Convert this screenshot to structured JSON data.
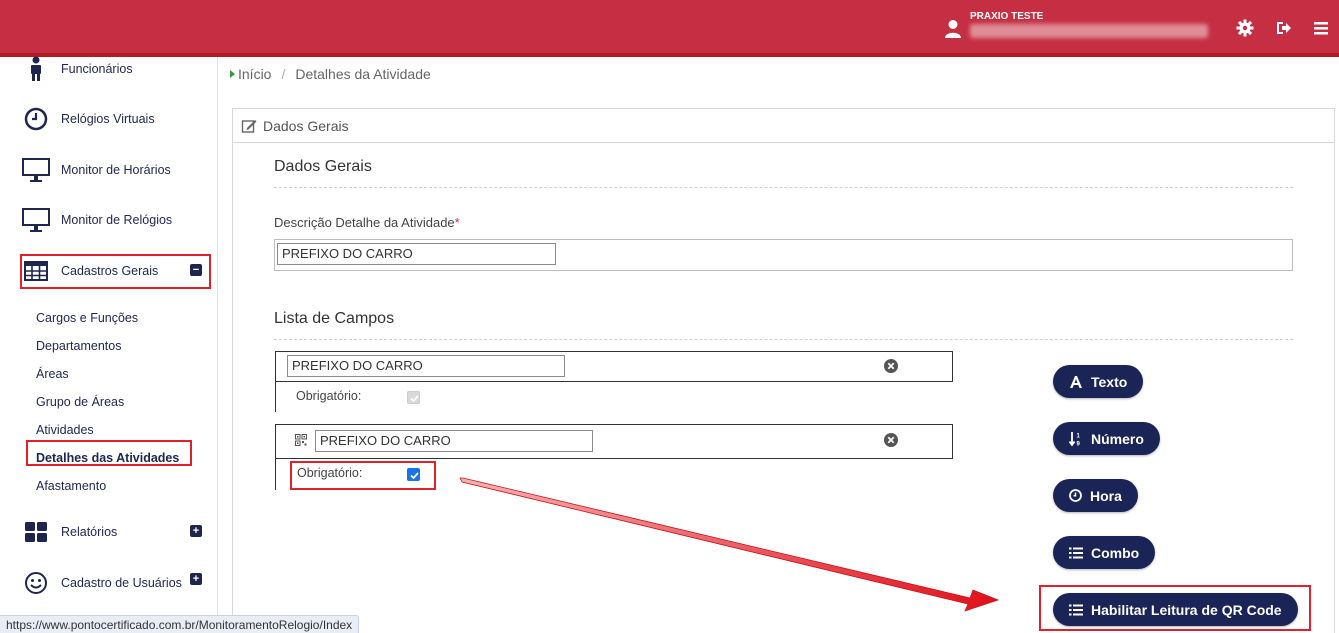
{
  "header": {
    "user_name": "PRAXIO TESTE",
    "user_email": "•••••••••••••••••",
    "icons": [
      "user-icon",
      "gear-icon",
      "logout-icon",
      "menu-icon"
    ],
    "bar_color": "#c62f43"
  },
  "sidebar": {
    "items": [
      {
        "label": "Funcionários",
        "icon": "person-icon"
      },
      {
        "label": "Relógios Virtuais",
        "icon": "clock-icon"
      },
      {
        "label": "Monitor de Horários",
        "icon": "monitor-icon"
      },
      {
        "label": "Monitor de Relógios",
        "icon": "monitor-icon"
      },
      {
        "label": "Cadastros Gerais",
        "icon": "table-icon"
      },
      {
        "label": "Relatórios",
        "icon": "grid-icon"
      },
      {
        "label": "Cadastro de Usuários",
        "icon": "smile-icon"
      }
    ],
    "sub_items": [
      "Cargos e Funções",
      "Departamentos",
      "Áreas",
      "Grupo de Áreas",
      "Atividades",
      "Detalhes das Atividades",
      "Afastamento"
    ],
    "active_sub_item": "Detalhes das Atividades"
  },
  "status_bar": {
    "url": "https://www.pontocertificado.com.br/MonitoramentoRelogio/Index"
  },
  "breadcrumb": {
    "home": "Início",
    "separator": "/",
    "current": "Detalhes da Atividade"
  },
  "panel": {
    "title": "Dados Gerais",
    "section_general": "Dados Gerais",
    "description_label": "Descrição Detalhe da Atividade",
    "required_mark": "*",
    "description_value": "PREFIXO DO CARRO",
    "section_fields": "Lista de Campos",
    "fields": [
      {
        "value": "PREFIXO DO CARRO",
        "obrigatorio_label": "Obrigatório:",
        "required": true,
        "editable": false
      },
      {
        "value": "PREFIXO DO CARRO",
        "obrigatorio_label": "Obrigatório:",
        "required": true,
        "editable": true,
        "icon": "qrcode-icon"
      }
    ]
  },
  "buttons": {
    "texto": "Texto",
    "numero": "Número",
    "hora": "Hora",
    "combo": "Combo",
    "qr": "Habilitar Leitura de QR Code",
    "color": "#1a2457"
  },
  "annotation": {
    "highlight_color": "#e0202a"
  }
}
